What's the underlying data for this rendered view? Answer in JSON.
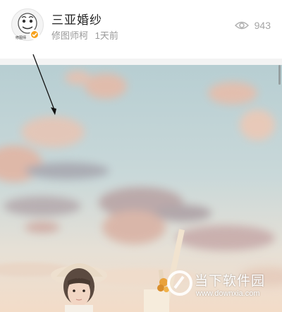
{
  "post": {
    "title": "三亚婚纱",
    "author": "修图师柯",
    "time": "1天前",
    "views": "943",
    "avatar_caption": "修图师"
  },
  "icons": {
    "views": "eye-icon",
    "verified": "verified-badge-icon",
    "annotation": "arrow-annotation"
  },
  "watermark": {
    "name": "当下软件园",
    "url": "www.downxia.com"
  },
  "colors": {
    "badge": "#f7a21c",
    "sky_top": "#b8cfd3",
    "sky_bottom": "#f1d9c6"
  }
}
